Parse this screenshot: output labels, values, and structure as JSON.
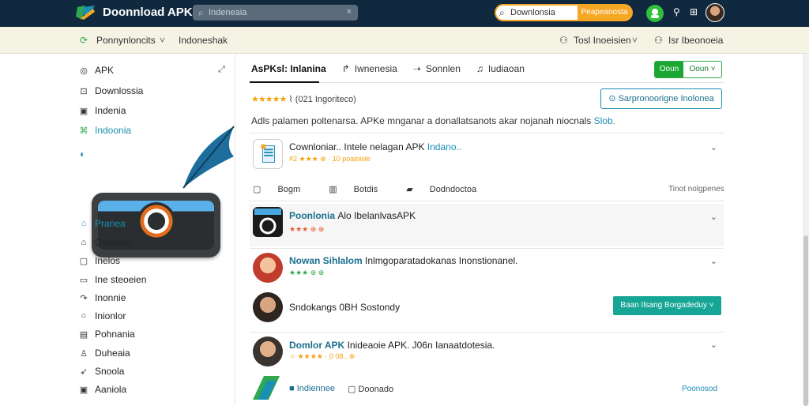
{
  "topbar": {
    "brand": "Doonnload APK",
    "search_value": "Indeneaia",
    "search_clear": "×",
    "pill_search_value": "Downlonsia",
    "pill_search_button": "Peapeanosta"
  },
  "subbar": {
    "left_item": "Ponnynloncits",
    "left_caret": "˅",
    "second_item": "Indoneshak",
    "right_item_1": "Tosl Inoeisien",
    "right_caret": "˅",
    "right_item_2": "Isr Ibeonoeia"
  },
  "sidebar": {
    "items_top": [
      {
        "label": "APK",
        "icon": "circle-icon"
      },
      {
        "label": "Downlossia",
        "icon": "download-icon"
      },
      {
        "label": "Indenia",
        "icon": "calendar-icon"
      },
      {
        "label": "Indoonia",
        "icon": "grid-icon"
      }
    ],
    "items_bottom": [
      {
        "label": "Pranea",
        "icon": "home-icon"
      },
      {
        "label": "Dadlesia",
        "icon": "file-icon"
      },
      {
        "label": "Inelos",
        "icon": "doc-icon"
      },
      {
        "label": "Ine steoeien",
        "icon": "chat-icon"
      },
      {
        "label": "Inonnie",
        "icon": "share-icon"
      },
      {
        "label": "Inionlor",
        "icon": "circle-icon"
      },
      {
        "label": "Pohnania",
        "icon": "book-icon"
      },
      {
        "label": "Duheaia",
        "icon": "person-icon"
      },
      {
        "label": "Snoola",
        "icon": "send-icon"
      },
      {
        "label": "Aaniola",
        "icon": "calendar-icon"
      }
    ]
  },
  "main": {
    "tabs": [
      "AsPKsl: Inlanina",
      "Iwnenesia",
      "Sonnlen",
      "Iudiaoan"
    ],
    "green_button_left": "Ooun",
    "green_button_right": "Ooun",
    "rating_stars": "★★★★★",
    "rating_text": "⌇ (021 Ingoriteco)",
    "outline_button": "Sarpronoorigne Inolonea",
    "description": "Adls palamen poltenarsa. APKe mnganar a donallatsanots akar nojanah niocnals ",
    "description_link": "Slob.",
    "app1": {
      "title": "Cownloniar.. Intele nelagan APK ",
      "title_link": "Indano..",
      "sub": "#2 ★★★ ⊕ · ᷊10 poaloisle"
    },
    "meta_labels": [
      "Bogm",
      "Botdis",
      "Dodndoctoa"
    ],
    "meta_right": "Tinot nolgpenes",
    "app2": {
      "title": "Poonlonia ",
      "title_rest": "Alo IbelanlvasAPK",
      "sub": "★★★ ⊕ ⊕"
    },
    "app3": {
      "title": "Nowan Sihlalom ",
      "title_rest": "Inlmgoparatadokanas Inonstionanel.",
      "sub": "★★★ ⊕ ⊕"
    },
    "app4": {
      "title": "Sndokangs 0BH Sostondy"
    },
    "teal_button": "Baan Ilsang Borgadeduy",
    "app5": {
      "title": "Domlor APK ",
      "title_rest": "Inideaoie APK. J06n Ianaatdotesia.",
      "sub": "☆ ★★★★ · ᷊0 08.. ⊕"
    },
    "footer_left": [
      "Indiennee",
      "Doonado"
    ],
    "footer_right": "Poonosod"
  },
  "colors": {
    "topbar": "#10293f",
    "accent_orange": "#f5a623",
    "accent_green": "#2fa84f",
    "accent_teal": "#17a595",
    "link_blue": "#1a8fb4"
  }
}
